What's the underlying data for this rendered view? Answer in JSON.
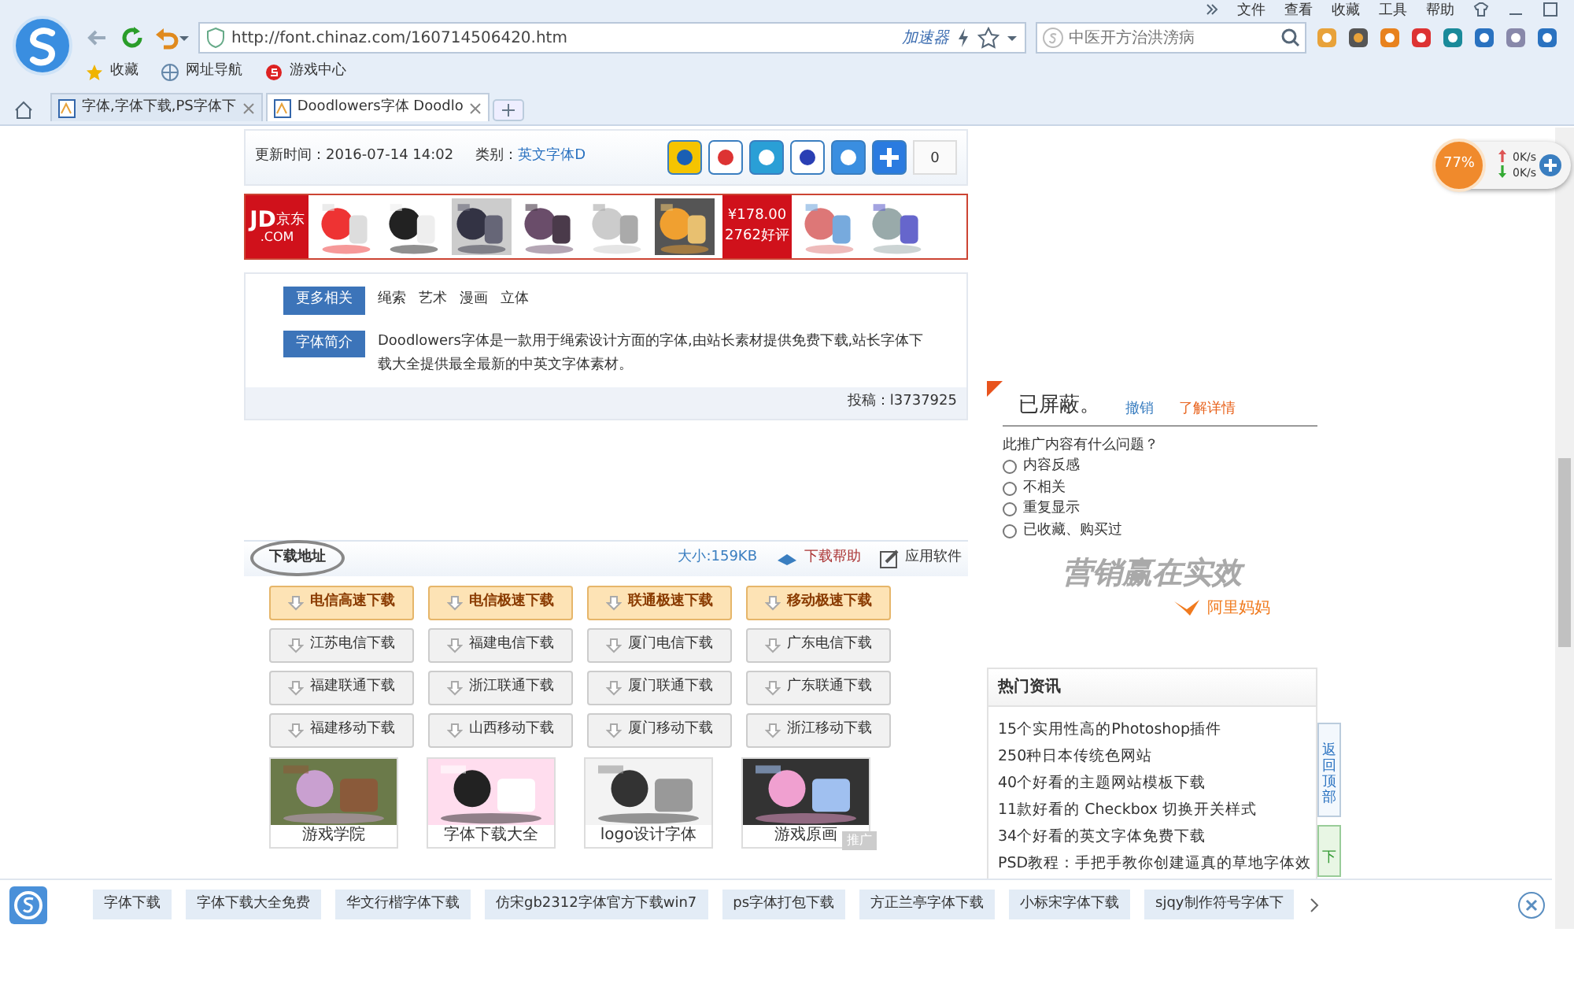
{
  "menu": [
    "文件",
    "查看",
    "收藏",
    "工具",
    "帮助"
  ],
  "address": {
    "url": "http://font.chinaz.com/160714506420.htm",
    "accelerator": "加速器"
  },
  "search": {
    "placeholder": "中医开方治洪滂病"
  },
  "bookmarks": [
    "收藏",
    "网址导航",
    "游戏中心"
  ],
  "tabs": [
    {
      "title": "字体,字体下载,PS字体下",
      "selected": false
    },
    {
      "title": "Doodlowers字体 Doodlo",
      "selected": true
    }
  ],
  "info": {
    "update": "更新时间：2016-07-14 14:02",
    "category_label": "类别：",
    "category": "英文字体D",
    "share_count": "0"
  },
  "ad": {
    "logo": "JD",
    "logo_cn": "京东",
    "logo_com": ".COM",
    "price": "¥178.00",
    "reviews": "2762好评"
  },
  "related": {
    "label": "更多相关",
    "tags": [
      "绳索",
      "艺术",
      "漫画",
      "立体"
    ]
  },
  "intro": {
    "label": "字体简介",
    "text": "Doodlowers字体是一款用于绳索设计方面的字体,由站长素材提供免费下载,站长字体下载大全提供最全最新的中英文字体素材。"
  },
  "contributor": "投稿：l3737925",
  "download": {
    "title": "下载地址",
    "size": "大小:159KB",
    "help": "下载帮助",
    "software": "应用软件",
    "links": [
      {
        "label": "电信高速下载",
        "kind": "fast"
      },
      {
        "label": "电信极速下载",
        "kind": "fast"
      },
      {
        "label": "联通极速下载",
        "kind": "fast"
      },
      {
        "label": "移动极速下载",
        "kind": "fast"
      },
      {
        "label": "江苏电信下载",
        "kind": "mirror"
      },
      {
        "label": "福建电信下载",
        "kind": "mirror"
      },
      {
        "label": "厦门电信下载",
        "kind": "mirror"
      },
      {
        "label": "广东电信下载",
        "kind": "mirror"
      },
      {
        "label": "福建联通下载",
        "kind": "mirror"
      },
      {
        "label": "浙江联通下载",
        "kind": "mirror"
      },
      {
        "label": "厦门联通下载",
        "kind": "mirror"
      },
      {
        "label": "广东联通下载",
        "kind": "mirror"
      },
      {
        "label": "福建移动下载",
        "kind": "mirror"
      },
      {
        "label": "山西移动下载",
        "kind": "mirror"
      },
      {
        "label": "厦门移动下载",
        "kind": "mirror"
      },
      {
        "label": "浙江移动下载",
        "kind": "mirror"
      }
    ],
    "promos": [
      "游戏学院",
      "字体下载大全",
      "logo设计字体",
      "游戏原画"
    ],
    "promo_tag": "推广"
  },
  "blocked": {
    "title": "已屏蔽。",
    "undo": "撤销",
    "learn": "了解详情",
    "question": "此推广内容有什么问题？",
    "options": [
      {
        "label": "内容反感",
        "selected": false
      },
      {
        "label": "不相关",
        "selected": false
      },
      {
        "label": "重复显示",
        "selected": false
      },
      {
        "label": "已收藏、购买过",
        "selected": false
      }
    ],
    "slogan": "营销赢在实效",
    "brand": "阿里妈妈"
  },
  "hot": {
    "title": "热门资讯",
    "items": [
      "15个实用性高的Photoshop插件",
      "250种日本传统色网站",
      "40个好看的主题网站模板下载",
      "11款好看的 Checkbox 切换开关样式",
      "34个好看的英文字体免费下载",
      "PSD教程：手把手教你创建逼真的草地字体效"
    ]
  },
  "back_top": "返回顶部",
  "side_tab": "下",
  "bottom_bar": [
    "字体下载",
    "字体下载大全免费",
    "华文行楷字体下载",
    "仿宋gb2312字体官方下载win7",
    "ps字体打包下载",
    "方正兰亭字体下载",
    "小标宋字体下载",
    "sjqy制作符号字体下"
  ],
  "monitor": {
    "percent": "77%",
    "up": "0K/s",
    "down": "0K/s"
  }
}
